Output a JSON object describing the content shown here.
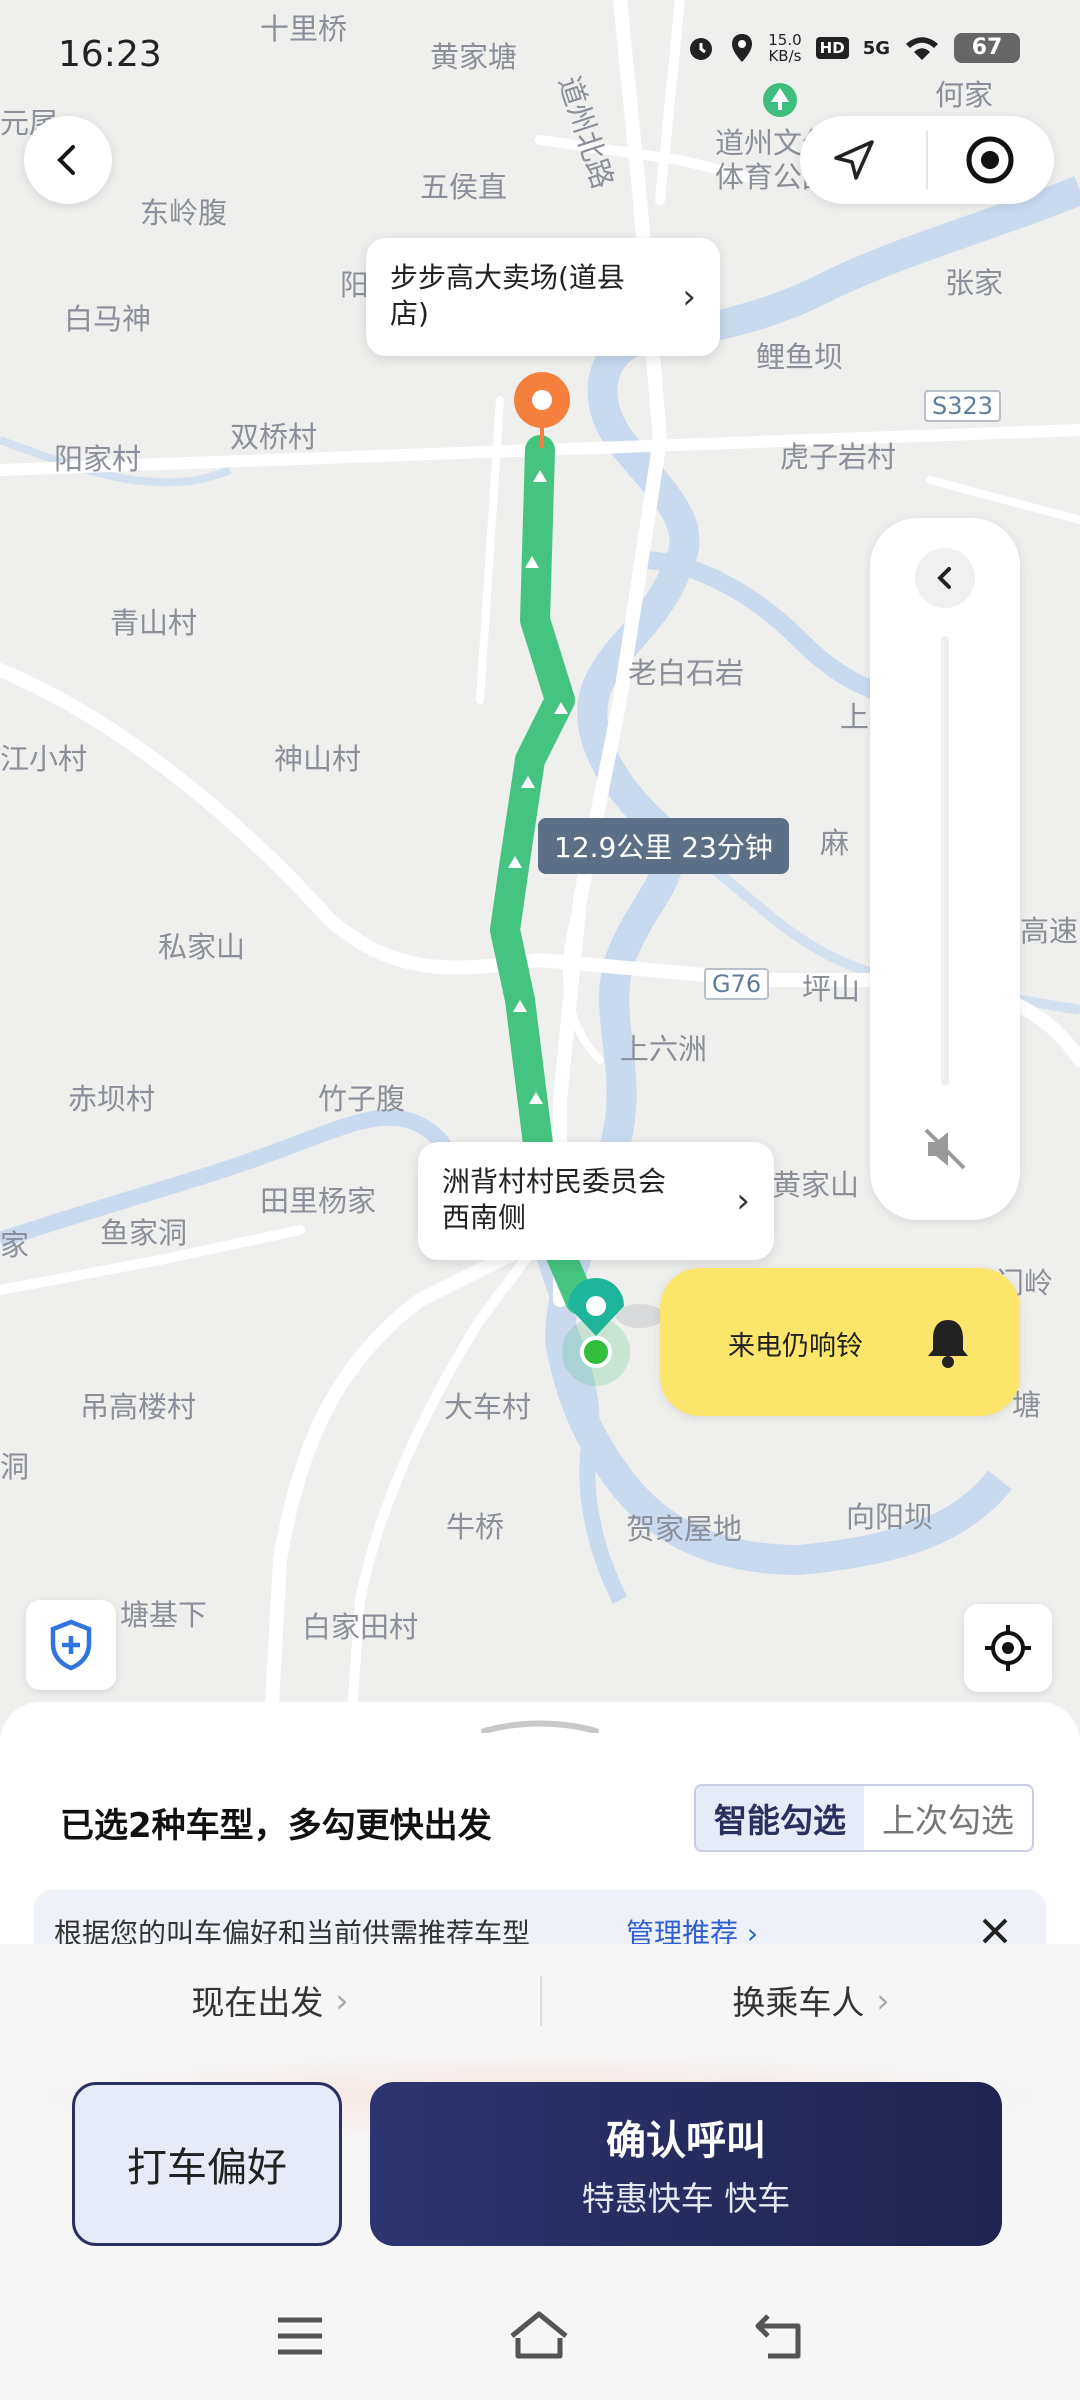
{
  "status_bar": {
    "time": "16:23",
    "net_speed_top": "15.0",
    "net_speed_bottom": "KB/s",
    "hd": "HD",
    "network": "5G",
    "battery": "67"
  },
  "map": {
    "places": [
      {
        "name": "十里桥",
        "id": "p1"
      },
      {
        "name": "黄家塘",
        "id": "p2"
      },
      {
        "name": "何家",
        "id": "p3"
      },
      {
        "name": "元尾",
        "id": "p4"
      },
      {
        "name": "道州北路",
        "id": "p5"
      },
      {
        "name": "道州文化",
        "id": "p6a"
      },
      {
        "name": "体育公园",
        "id": "p6b"
      },
      {
        "name": "五侯直",
        "id": "p7"
      },
      {
        "name": "东岭腹",
        "id": "p8"
      },
      {
        "name": "张家",
        "id": "p9"
      },
      {
        "name": "白马神",
        "id": "p10"
      },
      {
        "name": "鲤鱼坝",
        "id": "p11"
      },
      {
        "name": "阳家村",
        "id": "p12"
      },
      {
        "name": "双桥村",
        "id": "p13"
      },
      {
        "name": "虎子岩村",
        "id": "p14"
      },
      {
        "name": "青山村",
        "id": "p15"
      },
      {
        "name": "老白石岩",
        "id": "p16"
      },
      {
        "name": "江小村",
        "id": "p17"
      },
      {
        "name": "神山村",
        "id": "p18"
      },
      {
        "name": "上",
        "id": "p19"
      },
      {
        "name": "麻",
        "id": "p20"
      },
      {
        "name": "私家山",
        "id": "p21"
      },
      {
        "name": "坪山",
        "id": "p22"
      },
      {
        "name": "高速",
        "id": "p23"
      },
      {
        "name": "上六洲",
        "id": "p24"
      },
      {
        "name": "赤坝村",
        "id": "p25"
      },
      {
        "name": "竹子腹",
        "id": "p26"
      },
      {
        "name": "田里杨家",
        "id": "p27"
      },
      {
        "name": "黄家山",
        "id": "p28"
      },
      {
        "name": "家",
        "id": "p29"
      },
      {
        "name": "鱼家洞",
        "id": "p30"
      },
      {
        "name": "江门岭",
        "id": "p31"
      },
      {
        "name": "吊高楼村",
        "id": "p32"
      },
      {
        "name": "大车村",
        "id": "p33"
      },
      {
        "name": "塘",
        "id": "p34"
      },
      {
        "name": "洞",
        "id": "p35"
      },
      {
        "name": "牛桥",
        "id": "p36"
      },
      {
        "name": "贺家屋地",
        "id": "p37"
      },
      {
        "name": "向阳坝",
        "id": "p38"
      },
      {
        "name": "塘基下",
        "id": "p39"
      },
      {
        "name": "白家田村",
        "id": "p40"
      },
      {
        "name": "阳",
        "id": "p41"
      }
    ],
    "road_tags": {
      "s323": "S323",
      "g76": "G76"
    },
    "destination": "步步高大卖场(道县店)",
    "origin": "洲背村村民委员会西南侧",
    "route_summary": "12.9公里 23分钟",
    "ring_reminder": "来电仍响铃",
    "colors": {
      "route": "#45c481",
      "destination": "#f5803e",
      "origin": "#1fb59a",
      "reminder": "#fbe56a"
    }
  },
  "panel": {
    "title": "已选2种车型，多勾更快出发",
    "seg_smart": "智能勾选",
    "seg_last": "上次勾选",
    "notice_text": "根据您的叫车偏好和当前供需推荐车型",
    "notice_link": "管理推荐",
    "depart": "现在出发",
    "passenger": "换乘车人",
    "pref_button": "打车偏好",
    "confirm_title": "确认呼叫",
    "confirm_sub": "特惠快车 快车",
    "colors": {
      "confirm": "#2a3060",
      "segment_active": "#e7ebf7"
    }
  }
}
